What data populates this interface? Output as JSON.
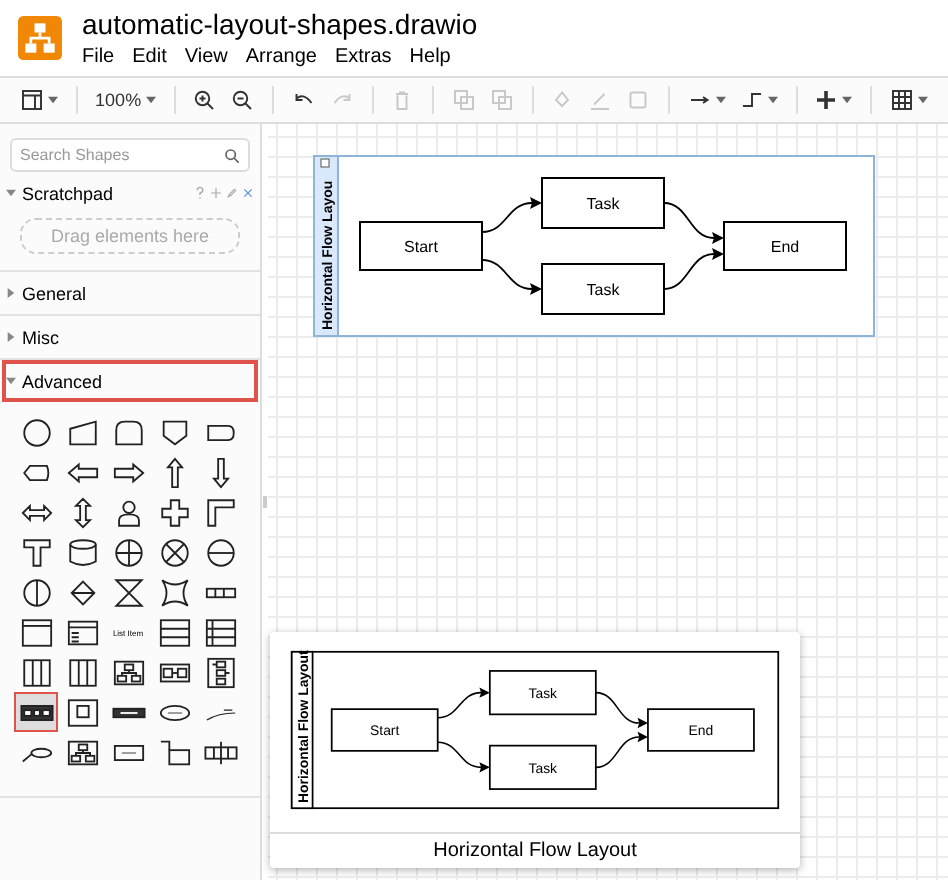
{
  "window": {
    "title": "automatic-layout-shapes.drawio"
  },
  "menu": [
    "File",
    "Edit",
    "View",
    "Arrange",
    "Extras",
    "Help"
  ],
  "toolbar": [
    [
      {
        "kind": "panel",
        "disabled": false
      }
    ],
    [
      {
        "kind": "zoom",
        "label": "100%",
        "disabled": false
      }
    ],
    [
      {
        "kind": "zoom-in",
        "disabled": false
      },
      {
        "kind": "zoom-out",
        "disabled": false
      }
    ],
    [
      {
        "kind": "undo",
        "disabled": false
      },
      {
        "kind": "redo",
        "disabled": true
      }
    ],
    [
      {
        "kind": "delete",
        "disabled": true
      }
    ],
    [
      {
        "kind": "to-front",
        "disabled": true
      },
      {
        "kind": "to-back",
        "disabled": true
      }
    ],
    [
      {
        "kind": "fill",
        "disabled": true
      },
      {
        "kind": "line",
        "disabled": true
      },
      {
        "kind": "shadow",
        "disabled": true
      }
    ],
    [
      {
        "kind": "connector",
        "disabled": false
      },
      {
        "kind": "waypoint",
        "disabled": false
      }
    ],
    [
      {
        "kind": "insert",
        "disabled": false
      }
    ],
    [
      {
        "kind": "table",
        "disabled": false
      }
    ]
  ],
  "sidebar": {
    "search": {
      "placeholder": "Search Shapes"
    },
    "scratchpad": {
      "title": "Scratchpad",
      "expanded": true,
      "drop_hint": "Drag elements here"
    },
    "sections": [
      {
        "label": "General",
        "expanded": false,
        "highlighted": false
      },
      {
        "label": "Misc",
        "expanded": false,
        "highlighted": false
      },
      {
        "label": "Advanced",
        "expanded": true,
        "highlighted": true
      }
    ],
    "shapes": [
      {
        "kind": "circle",
        "selected": false
      },
      {
        "kind": "trapezoid",
        "selected": false
      },
      {
        "kind": "rounded",
        "selected": false
      },
      {
        "kind": "offpage",
        "selected": false
      },
      {
        "kind": "tab",
        "selected": false
      },
      {
        "kind": "display",
        "selected": false
      },
      {
        "kind": "arrow-left",
        "selected": false
      },
      {
        "kind": "arrow-right",
        "selected": false
      },
      {
        "kind": "arrow-up",
        "selected": false
      },
      {
        "kind": "arrow-down",
        "selected": false
      },
      {
        "kind": "arrow-h",
        "selected": false
      },
      {
        "kind": "arrow-v",
        "selected": false
      },
      {
        "kind": "person",
        "selected": false
      },
      {
        "kind": "cross",
        "selected": false
      },
      {
        "kind": "corner",
        "selected": false
      },
      {
        "kind": "tee",
        "selected": false
      },
      {
        "kind": "cylinder",
        "selected": false
      },
      {
        "kind": "circle-plus",
        "selected": false
      },
      {
        "kind": "circle-x",
        "selected": false
      },
      {
        "kind": "circle-minus",
        "selected": false
      },
      {
        "kind": "circle-bar",
        "selected": false
      },
      {
        "kind": "sort",
        "selected": false
      },
      {
        "kind": "hourglass",
        "selected": false
      },
      {
        "kind": "star",
        "selected": false
      },
      {
        "kind": "chain",
        "selected": false
      },
      {
        "kind": "window",
        "selected": false
      },
      {
        "kind": "form",
        "selected": false
      },
      {
        "kind": "text",
        "label": "List Item",
        "selected": false
      },
      {
        "kind": "list",
        "selected": false
      },
      {
        "kind": "list-split",
        "selected": false
      },
      {
        "kind": "columns",
        "selected": false
      },
      {
        "kind": "columns",
        "selected": false
      },
      {
        "kind": "tree",
        "selected": false
      },
      {
        "kind": "flow-pair",
        "selected": false
      },
      {
        "kind": "tree-v",
        "selected": false
      },
      {
        "kind": "flow-h",
        "selected": true
      },
      {
        "kind": "frame",
        "selected": false
      },
      {
        "kind": "flow-bar",
        "selected": false
      },
      {
        "kind": "ellipse",
        "selected": false
      },
      {
        "kind": "line-label",
        "selected": false
      },
      {
        "kind": "line-ellipse",
        "selected": false
      },
      {
        "kind": "tree",
        "selected": false
      },
      {
        "kind": "rect-label",
        "selected": false
      },
      {
        "kind": "elbow-box",
        "selected": false
      },
      {
        "kind": "bus",
        "selected": false
      }
    ]
  },
  "diagram": {
    "lane": {
      "title": "Horizontal Flow Layou",
      "highlighted": true
    },
    "nodes": [
      {
        "label": "Start"
      },
      {
        "label": "Task"
      },
      {
        "label": "Task"
      },
      {
        "label": "End"
      }
    ]
  },
  "preview": {
    "title": "Horizontal Flow Layout",
    "lane": {
      "title": "Horizontal Flow Layout",
      "highlighted": false
    },
    "nodes": [
      {
        "label": "Start"
      },
      {
        "label": "Task"
      },
      {
        "label": "Task"
      },
      {
        "label": "End"
      }
    ]
  }
}
